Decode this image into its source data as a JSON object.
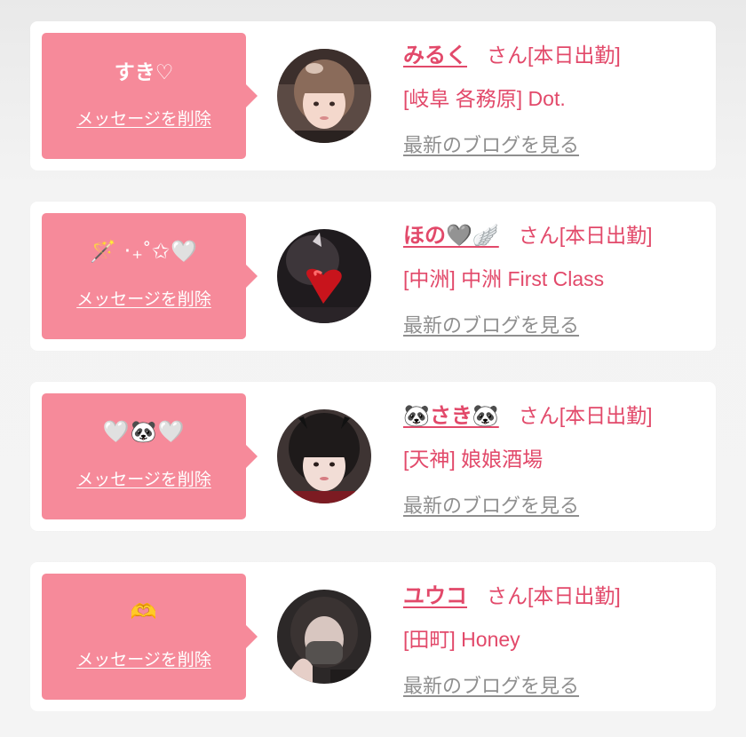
{
  "cards": [
    {
      "message": "すき♡",
      "delete_label": "メッセージを削除",
      "name": "みるく",
      "honorific": "さん",
      "status": "[本日出勤]",
      "location": "[岐阜 各務原] Dot.",
      "blog_label": "最新のブログを見る",
      "avatar_tone": "#6b5a54"
    },
    {
      "message": "🪄 ‧₊˚✩🤍",
      "delete_label": "メッセージを削除",
      "name": "ほの🩶🪽",
      "honorific": "さん",
      "status": "[本日出勤]",
      "location": "[中洲] 中洲 First Class",
      "blog_label": "最新のブログを見る",
      "avatar_tone": "#2f2a2e"
    },
    {
      "message": "🤍🐼🤍",
      "delete_label": "メッセージを削除",
      "name": "🐼さき🐼",
      "honorific": "さん",
      "status": "[本日出勤]",
      "location": "[天神] 娘娘酒場",
      "blog_label": "最新のブログを見る",
      "avatar_tone": "#4a3c3a"
    },
    {
      "message": "🫶",
      "delete_label": "メッセージを削除",
      "name": "ユウコ",
      "honorific": "さん",
      "status": "[本日出勤]",
      "location": "[田町] Honey",
      "blog_label": "最新のブログを見る",
      "avatar_tone": "#3b3636"
    }
  ],
  "colors": {
    "bubble": "#f68a9a",
    "accent": "#e2496a",
    "link_gray": "#8f8f8f"
  }
}
